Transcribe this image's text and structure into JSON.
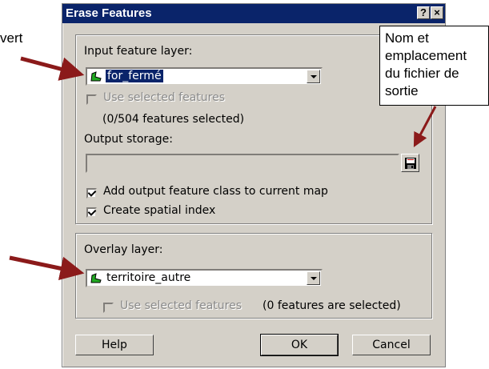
{
  "dialog": {
    "title": "Erase Features",
    "help_title_button": "?",
    "close_title_button": "×"
  },
  "input_group": {
    "input_layer_label": "Input feature layer:",
    "input_layer_value": "for_fermé",
    "use_selected_label": "Use selected features",
    "selection_count": "(0/504 features selected)",
    "output_storage_label": "Output storage:",
    "output_storage_value": "",
    "add_output_label": "Add output feature class to current map",
    "add_output_checked": true,
    "spatial_index_label": "Create spatial index",
    "spatial_index_checked": true
  },
  "overlay_group": {
    "overlay_layer_label": "Overlay layer:",
    "overlay_layer_value": "territoire_autre",
    "use_selected_label": "Use selected features",
    "selection_count": "(0 features are selected)"
  },
  "buttons": {
    "help": "Help",
    "ok": "OK",
    "cancel": "Cancel"
  },
  "annotations": {
    "callout_text": "Nom et\nemplacement\ndu fichier de\nsortie",
    "cut_left_label": "vert"
  },
  "icons": {
    "layer_icon": "polygon-layer-icon",
    "save_icon": "floppy-disk-icon"
  },
  "colors": {
    "title_bar": "#0a246a",
    "dialog_face": "#d4d0c8",
    "selection_highlight": "#0a246a",
    "annotation_arrow": "#8b1a1a",
    "layer_icon_green": "#22aa22"
  }
}
